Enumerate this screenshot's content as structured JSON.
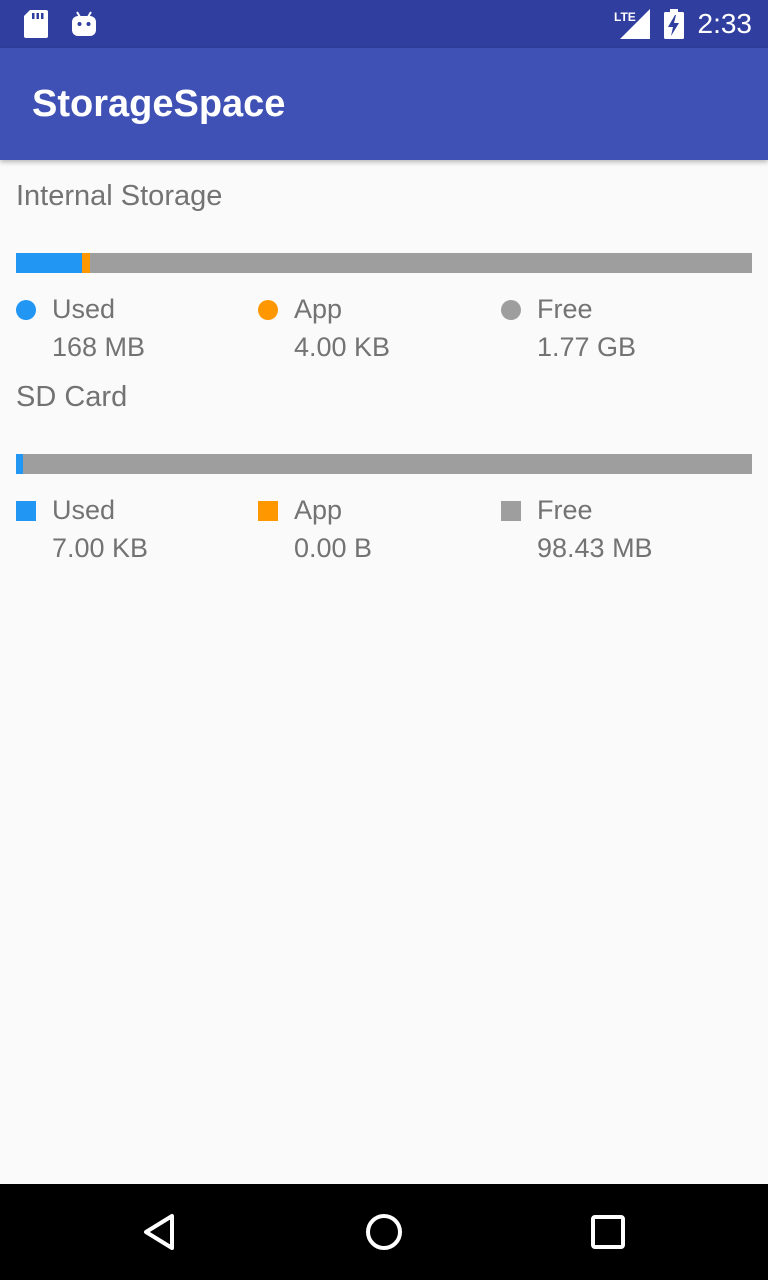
{
  "status_bar": {
    "time": "2:33",
    "icons": [
      "sd-card-icon",
      "android-icon",
      "lte-signal-icon",
      "battery-charging-icon"
    ],
    "lte_label": "LTE"
  },
  "app_bar": {
    "title": "StorageSpace"
  },
  "colors": {
    "used": "#2196f3",
    "app": "#ff9800",
    "free": "#9e9e9e",
    "status_bar": "#303f9f",
    "app_bar": "#3f51b5"
  },
  "internal_storage": {
    "title": "Internal Storage",
    "bar_fraction": {
      "used": 0.09,
      "app": 0.01,
      "free": 0.9
    },
    "legend": [
      {
        "label": "Used",
        "value": "168 MB"
      },
      {
        "label": "App",
        "value": "4.00 KB"
      },
      {
        "label": "Free",
        "value": "1.77 GB"
      }
    ]
  },
  "sd_card": {
    "title": "SD Card",
    "bar_fraction": {
      "used": 0.01,
      "app": 0.0,
      "free": 0.99
    },
    "legend": [
      {
        "label": "Used",
        "value": "7.00 KB"
      },
      {
        "label": "App",
        "value": "0.00 B"
      },
      {
        "label": "Free",
        "value": "98.43 MB"
      }
    ]
  },
  "nav_bar": {
    "icons": [
      "back-icon",
      "home-icon",
      "recents-icon"
    ]
  }
}
